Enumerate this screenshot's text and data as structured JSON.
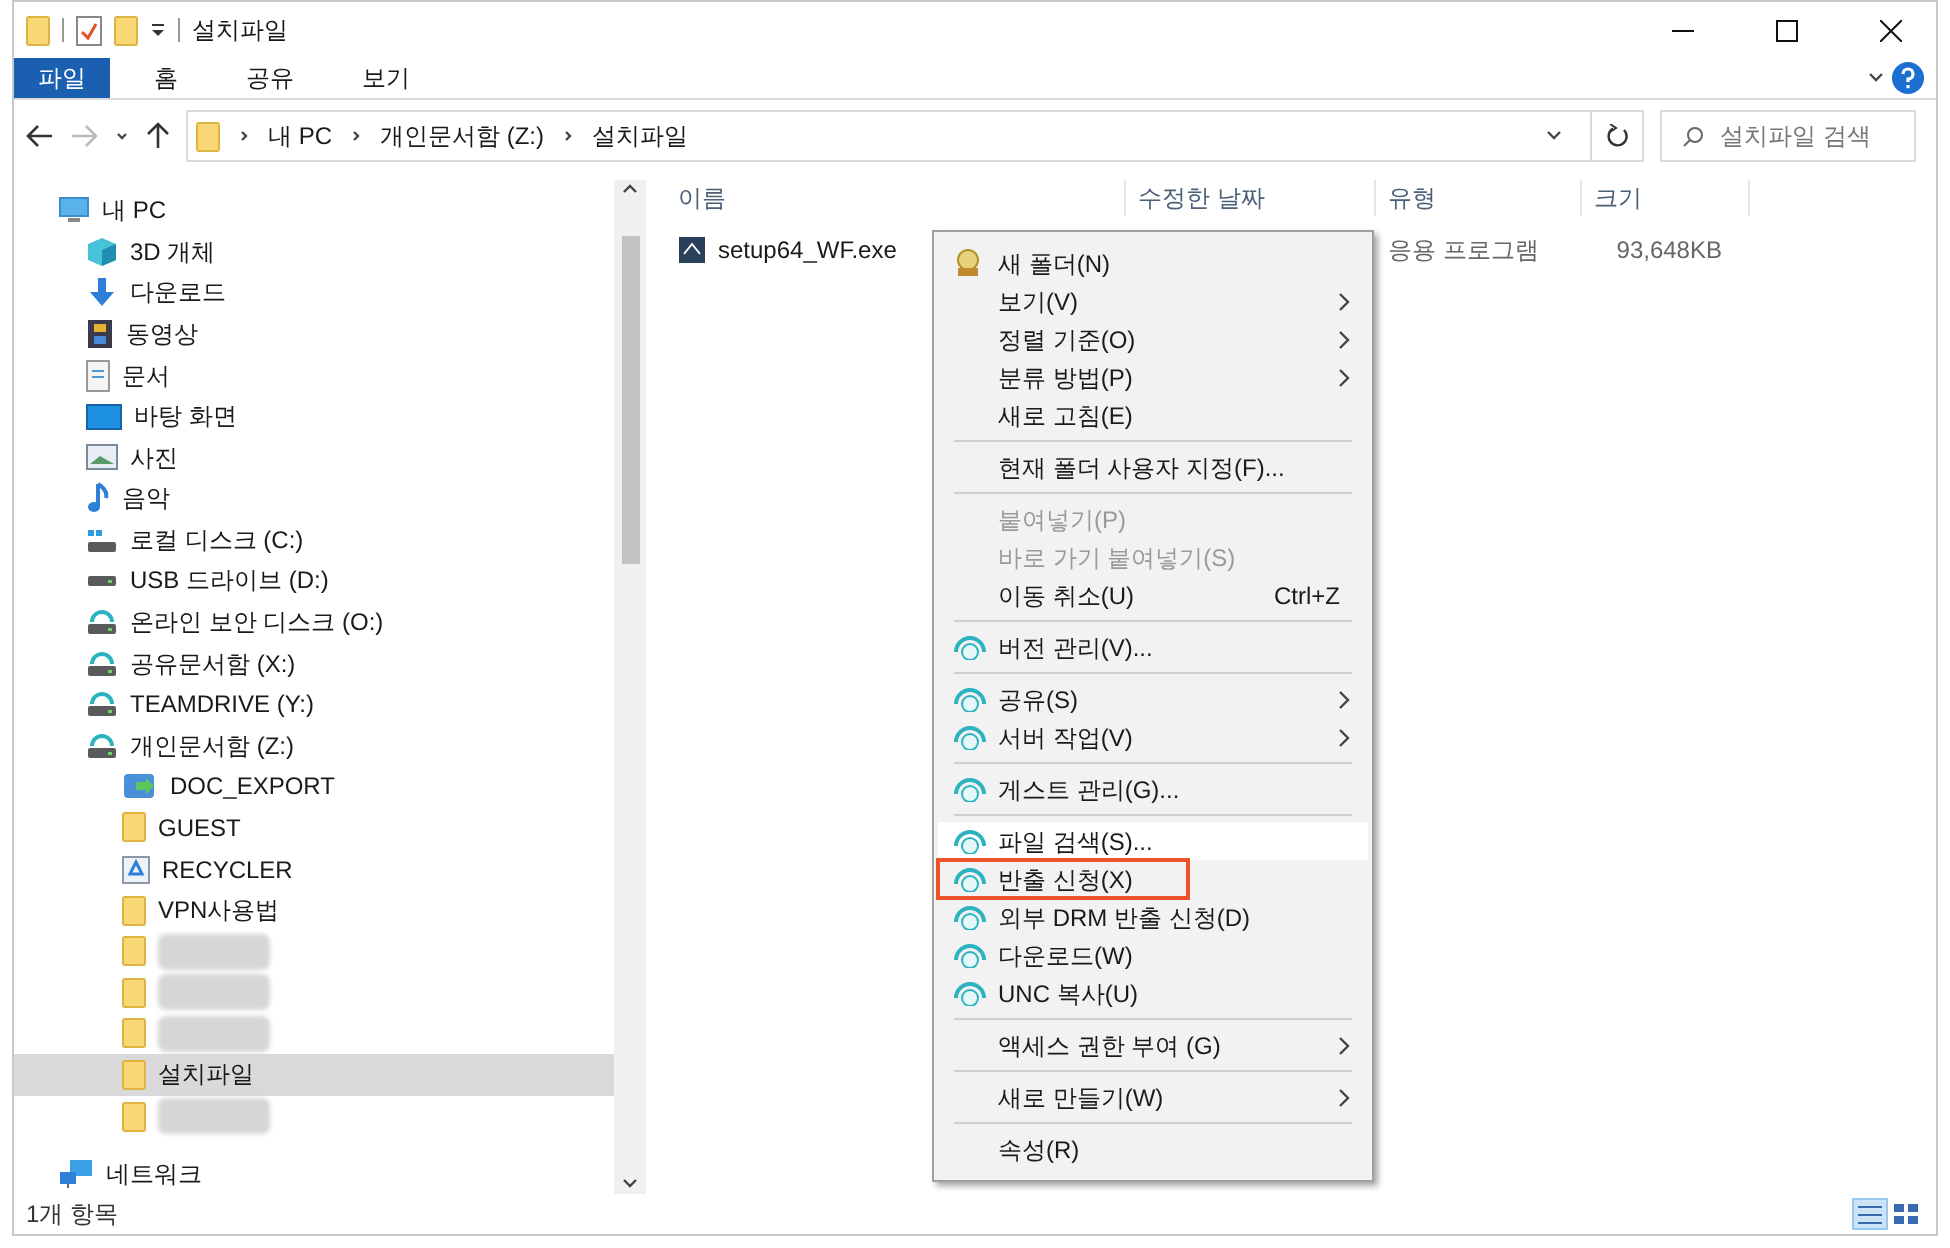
{
  "window": {
    "title": "설치파일"
  },
  "ribbon_tabs": [
    {
      "label": "파일",
      "selected": true
    },
    {
      "label": "홈",
      "selected": false
    },
    {
      "label": "공유",
      "selected": false
    },
    {
      "label": "보기",
      "selected": false
    }
  ],
  "address_bar": {
    "breadcrumbs": [
      "내 PC",
      "개인문서함 (Z:)",
      "설치파일"
    ]
  },
  "search": {
    "placeholder": "설치파일 검색"
  },
  "sidebar": {
    "items": [
      {
        "label": "내 PC",
        "kind": "pc",
        "selected": false,
        "children": [
          {
            "label": "3D 개체",
            "kind": "cube",
            "selected": false
          },
          {
            "label": "다운로드",
            "kind": "download",
            "selected": false
          },
          {
            "label": "동영상",
            "kind": "video",
            "selected": false
          },
          {
            "label": "문서",
            "kind": "document",
            "selected": false
          },
          {
            "label": "바탕 화면",
            "kind": "desktop",
            "selected": false
          },
          {
            "label": "사진",
            "kind": "picture",
            "selected": false
          },
          {
            "label": "음악",
            "kind": "music",
            "selected": false
          },
          {
            "label": "로컬 디스크 (C:)",
            "kind": "local-disk",
            "selected": false
          },
          {
            "label": "USB 드라이브 (D:)",
            "kind": "usb-drive",
            "selected": false
          },
          {
            "label": "온라인 보안 디스크 (O:)",
            "kind": "network-drive",
            "selected": false
          },
          {
            "label": "공유문서함 (X:)",
            "kind": "network-drive",
            "selected": false
          },
          {
            "label": "TEAMDRIVE (Y:)",
            "kind": "network-drive",
            "selected": false
          },
          {
            "label": "개인문서함 (Z:)",
            "kind": "network-drive",
            "selected": false,
            "children": [
              {
                "label": "DOC_EXPORT",
                "kind": "export",
                "selected": false
              },
              {
                "label": "GUEST",
                "kind": "folder",
                "selected": false
              },
              {
                "label": "RECYCLER",
                "kind": "recycler",
                "selected": false
              },
              {
                "label": "VPN사용법",
                "kind": "folder",
                "selected": false
              },
              {
                "kind": "redacted-folder",
                "selected": false
              },
              {
                "kind": "redacted-folder",
                "selected": false
              },
              {
                "kind": "redacted-folder",
                "selected": false
              },
              {
                "label": "설치파일",
                "kind": "folder",
                "selected": true
              },
              {
                "kind": "redacted-folder",
                "selected": false
              }
            ]
          }
        ]
      },
      {
        "label": "네트워크",
        "kind": "network",
        "selected": false
      }
    ]
  },
  "table": {
    "columns": [
      "이름",
      "수정한 날짜",
      "유형",
      "크기"
    ],
    "rows": [
      {
        "name": "setup64_WF.exe",
        "type": "응용 프로그램",
        "size": "93,648KB"
      }
    ]
  },
  "context_menu": {
    "items": [
      {
        "kind": "folder-item",
        "label": "새 폴더(N)",
        "submenu": false,
        "disabled": false,
        "hovered": false,
        "annotated": false
      },
      {
        "kind": "item",
        "label": "보기(V)",
        "submenu": true,
        "disabled": false,
        "hovered": false,
        "annotated": false
      },
      {
        "kind": "item",
        "label": "정렬 기준(O)",
        "submenu": true,
        "disabled": false,
        "hovered": false,
        "annotated": false
      },
      {
        "kind": "item",
        "label": "분류 방법(P)",
        "submenu": true,
        "disabled": false,
        "hovered": false,
        "annotated": false
      },
      {
        "kind": "item",
        "label": "새로 고침(E)",
        "submenu": false,
        "disabled": false,
        "hovered": false,
        "annotated": false
      },
      {
        "kind": "separator"
      },
      {
        "kind": "item",
        "label": "현재 폴더 사용자 지정(F)...",
        "submenu": false,
        "disabled": false,
        "hovered": false,
        "annotated": false
      },
      {
        "kind": "separator"
      },
      {
        "kind": "item",
        "label": "붙여넣기(P)",
        "submenu": false,
        "disabled": true,
        "hovered": false,
        "annotated": false
      },
      {
        "kind": "item",
        "label": "바로 가기 붙여넣기(S)",
        "submenu": false,
        "disabled": true,
        "hovered": false,
        "annotated": false
      },
      {
        "kind": "item",
        "label": "이동 취소(U)",
        "shortcut": "Ctrl+Z",
        "submenu": false,
        "disabled": false,
        "hovered": false,
        "annotated": false
      },
      {
        "kind": "separator"
      },
      {
        "kind": "dxc-item",
        "label": "버전 관리(V)...",
        "submenu": false,
        "disabled": false,
        "hovered": false,
        "annotated": false
      },
      {
        "kind": "separator"
      },
      {
        "kind": "dxc-item",
        "label": "공유(S)",
        "submenu": true,
        "disabled": false,
        "hovered": false,
        "annotated": false
      },
      {
        "kind": "dxc-item",
        "label": "서버 작업(V)",
        "submenu": true,
        "disabled": false,
        "hovered": false,
        "annotated": false
      },
      {
        "kind": "separator"
      },
      {
        "kind": "dxc-item",
        "label": "게스트 관리(G)...",
        "submenu": false,
        "disabled": false,
        "hovered": false,
        "annotated": false
      },
      {
        "kind": "separator"
      },
      {
        "kind": "dxc-item",
        "label": "파일 검색(S)...",
        "submenu": false,
        "disabled": false,
        "hovered": true,
        "annotated": false
      },
      {
        "kind": "dxc-item",
        "label": "반출 신청(X)",
        "submenu": false,
        "disabled": false,
        "hovered": false,
        "annotated": true
      },
      {
        "kind": "dxc-item",
        "label": "외부 DRM 반출 신청(D)",
        "submenu": false,
        "disabled": false,
        "hovered": false,
        "annotated": false
      },
      {
        "kind": "dxc-item",
        "label": "다운로드(W)",
        "submenu": false,
        "disabled": false,
        "hovered": false,
        "annotated": false
      },
      {
        "kind": "dxc-item",
        "label": "UNC 복사(U)",
        "submenu": false,
        "disabled": false,
        "hovered": false,
        "annotated": false
      },
      {
        "kind": "separator"
      },
      {
        "kind": "item",
        "label": "액세스 권한 부여 (G)",
        "submenu": true,
        "disabled": false,
        "hovered": false,
        "annotated": false
      },
      {
        "kind": "separator"
      },
      {
        "kind": "item",
        "label": "새로 만들기(W)",
        "submenu": true,
        "disabled": false,
        "hovered": false,
        "annotated": false
      },
      {
        "kind": "separator"
      },
      {
        "kind": "item",
        "label": "속성(R)",
        "submenu": false,
        "disabled": false,
        "hovered": false,
        "annotated": false
      }
    ]
  },
  "status_bar": {
    "item_count": "1개 항목"
  },
  "view_buttons": [
    {
      "kind": "details",
      "selected": true
    },
    {
      "kind": "large-icons",
      "selected": false
    }
  ]
}
